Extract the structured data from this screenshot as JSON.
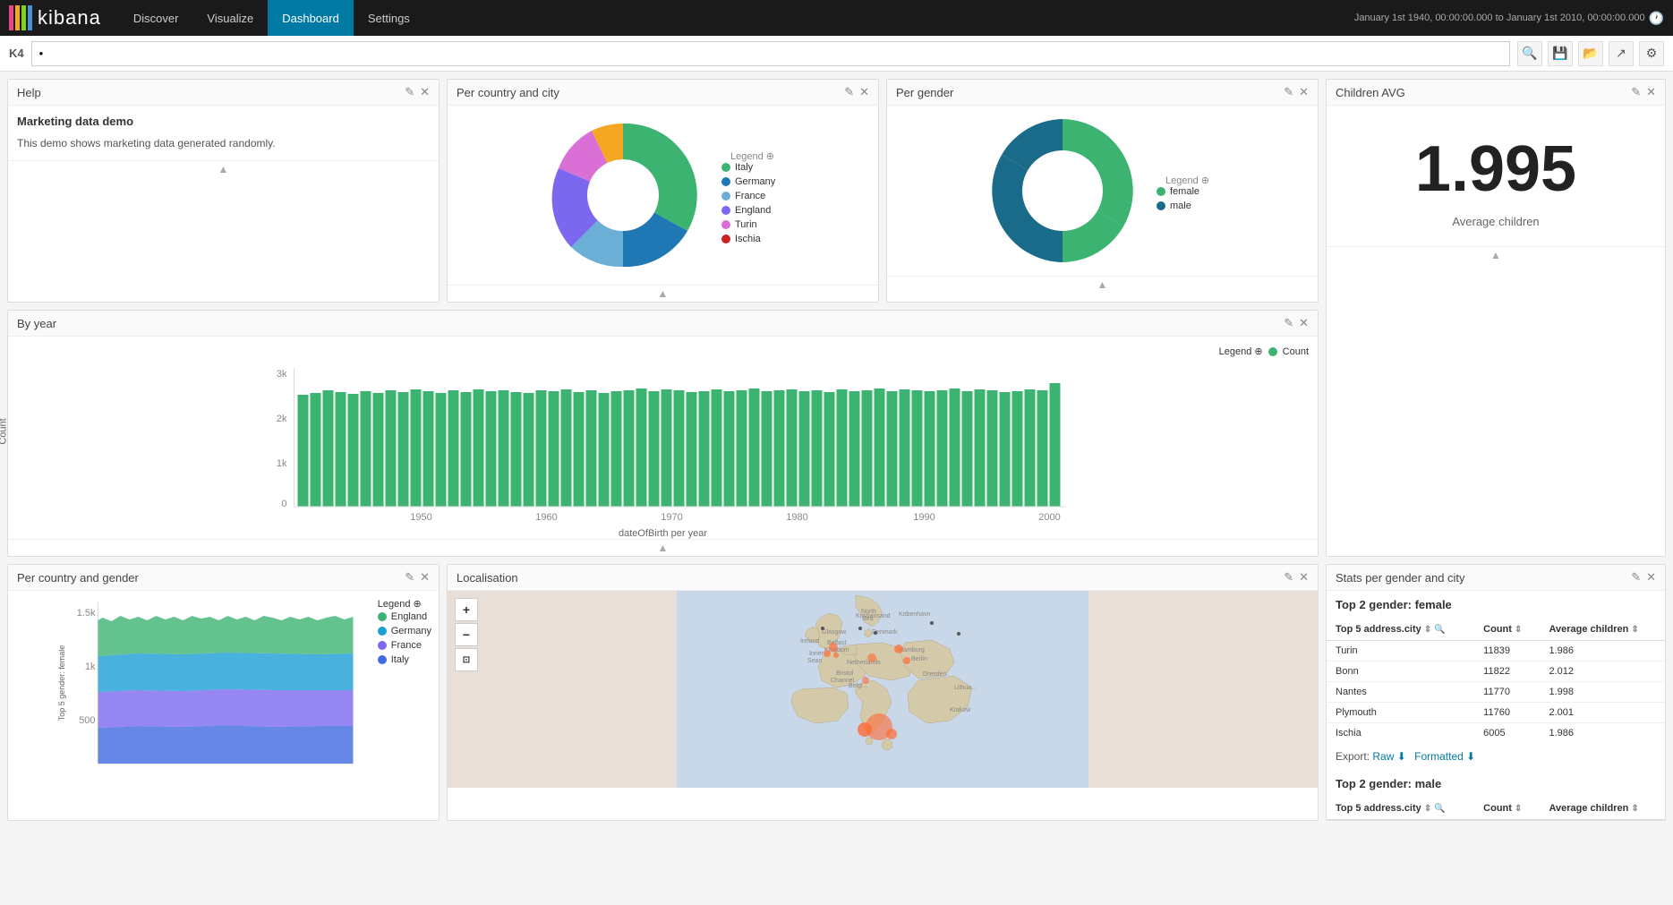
{
  "nav": {
    "logo": "kibana",
    "items": [
      "Discover",
      "Visualize",
      "Dashboard",
      "Settings"
    ],
    "active": "Dashboard",
    "timeRange": "January 1st 1940, 00:00:00.000 to January 1st 2010, 00:00:00.000"
  },
  "search": {
    "label": "K4",
    "placeholder": "•",
    "icons": [
      "document",
      "save",
      "open",
      "share",
      "settings"
    ]
  },
  "panels": {
    "help": {
      "title": "Help",
      "content_title": "Marketing data demo",
      "content_text": "This demo shows marketing data generated randomly."
    },
    "per_country_city": {
      "title": "Per country and city",
      "legend_title": "Legend",
      "legend_items": [
        {
          "label": "Italy",
          "color": "#3cb371"
        },
        {
          "label": "Germany",
          "color": "#1f77b4"
        },
        {
          "label": "France",
          "color": "#6baed6"
        },
        {
          "label": "England",
          "color": "#7b68ee"
        },
        {
          "label": "Turin",
          "color": "#da70d6"
        },
        {
          "label": "Ischia",
          "color": "#cc2222"
        }
      ]
    },
    "per_gender": {
      "title": "Per gender",
      "legend_title": "Legend",
      "legend_items": [
        {
          "label": "female",
          "color": "#3cb371"
        },
        {
          "label": "male",
          "color": "#1a6b8a"
        }
      ]
    },
    "children_avg": {
      "title": "Children AVG",
      "value": "1.995",
      "label": "Average children"
    },
    "by_year": {
      "title": "By year",
      "legend_label": "Count",
      "legend_color": "#3cb371",
      "x_axis_label": "dateOfBirth per year",
      "y_axis_label": "Count",
      "y_ticks": [
        "0",
        "1k",
        "2k",
        "3k"
      ],
      "x_ticks": [
        "1950",
        "1960",
        "1970",
        "1980",
        "1990",
        "2000"
      ]
    },
    "stats": {
      "title": "Stats per gender and city",
      "top_female": {
        "section_title": "Top 2 gender: female",
        "col1": "Top 5 address.city",
        "col2": "Count",
        "col3": "Average children",
        "rows": [
          {
            "city": "Turin",
            "count": "11839",
            "avg": "1.986"
          },
          {
            "city": "Bonn",
            "count": "11822",
            "avg": "2.012"
          },
          {
            "city": "Nantes",
            "count": "11770",
            "avg": "1.998"
          },
          {
            "city": "Plymouth",
            "count": "11760",
            "avg": "2.001"
          },
          {
            "city": "Ischia",
            "count": "6005",
            "avg": "1.986"
          }
        ]
      },
      "top_male": {
        "section_title": "Top 2 gender: male",
        "col1": "Top 5 address.city",
        "col2": "Count",
        "col3": "Average children",
        "rows": []
      },
      "export": {
        "label": "Export:",
        "raw": "Raw",
        "formatted": "Formatted"
      }
    },
    "per_country_gender": {
      "title": "Per country and gender",
      "legend_items": [
        {
          "label": "England",
          "color": "#3cb371"
        },
        {
          "label": "Germany",
          "color": "#1a9ed4"
        },
        {
          "label": "France",
          "color": "#7b68ee"
        },
        {
          "label": "Italy",
          "color": "#4169e1"
        }
      ],
      "y_axis_label": "Top 5 gender: female",
      "y_ticks": [
        "500",
        "1k",
        "1.5k"
      ]
    },
    "localisation": {
      "title": "Localisation"
    }
  }
}
